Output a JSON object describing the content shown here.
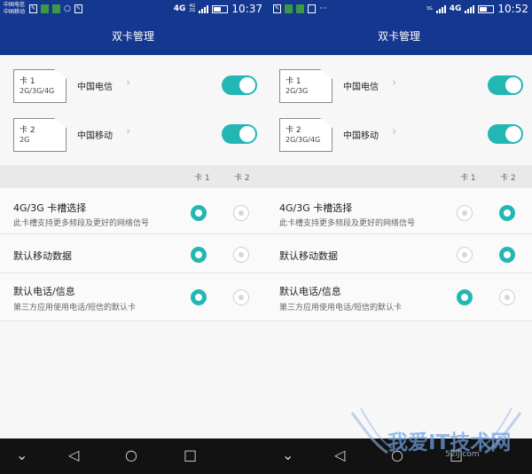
{
  "app_title": "双卡管理",
  "column_headers": {
    "card1": "卡 1",
    "card2": "卡 2"
  },
  "settings_labels": {
    "slot": "4G/3G 卡槽选择",
    "slot_desc": "此卡槽支持更多频段及更好的网络信号",
    "data": "默认移动数据",
    "call": "默认电话/信息",
    "call_desc": "第三方应用使用电话/短信的默认卡"
  },
  "nav": {
    "hide": "⌄",
    "back": "◁",
    "home": "○",
    "recent": "□"
  },
  "colors": {
    "header": "#14378f",
    "accent": "#23b7b3"
  },
  "screens": [
    {
      "status": {
        "carrier1": "中国电信",
        "carrier2": "中国移动",
        "net": "4G",
        "net_small_top": "4G",
        "net_small_bottom": "2G",
        "time": "10:37",
        "icons": [
          "edit-icon",
          "sim-icon",
          "sim-icon",
          "chat-icon",
          "edit-icon"
        ]
      },
      "sims": [
        {
          "card": "卡 1",
          "types": "2G/3G/4G",
          "operator": "中国电信",
          "enabled": true
        },
        {
          "card": "卡 2",
          "types": "2G",
          "operator": "中国移动",
          "enabled": true
        }
      ],
      "selected": {
        "slot": 1,
        "data": 1,
        "call": 1
      }
    },
    {
      "status": {
        "carrier1": "",
        "carrier2": "",
        "net": "4G",
        "net_small_top": "3G",
        "net_small_bottom": "",
        "time": "10:52",
        "icons": [
          "edit-icon",
          "sim-icon",
          "sim-icon",
          "image-icon",
          "more-icon"
        ]
      },
      "sims": [
        {
          "card": "卡 1",
          "types": "2G/3G",
          "operator": "中国电信",
          "enabled": true
        },
        {
          "card": "卡 2",
          "types": "2G/3G/4G",
          "operator": "中国移动",
          "enabled": true
        }
      ],
      "selected": {
        "slot": 2,
        "data": 2,
        "call": 1
      }
    }
  ],
  "watermark": {
    "text": "我爱IT技术网",
    "url": "52ij.com"
  }
}
